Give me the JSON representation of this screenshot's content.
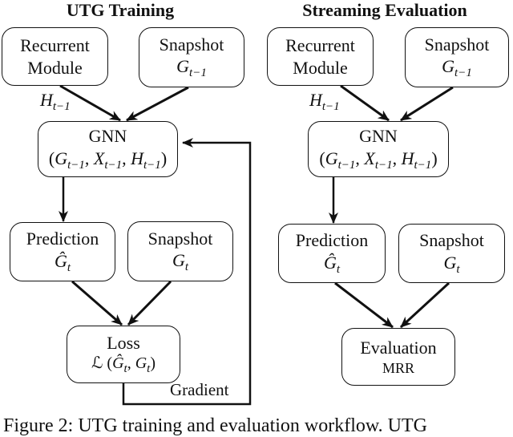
{
  "panels": [
    {
      "title": "UTG Training",
      "recurrent": {
        "line1": "Recurrent",
        "line2": "Module"
      },
      "snapshot_prev": {
        "label": "Snapshot",
        "math": "G",
        "sub": "t−1"
      },
      "h_label": {
        "math": "H",
        "sub": "t−1"
      },
      "gnn": {
        "label": "GNN",
        "args": [
          {
            "math": "G",
            "sub": "t−1"
          },
          {
            "math": "X",
            "sub": "t−1"
          },
          {
            "math": "H",
            "sub": "t−1"
          }
        ]
      },
      "prediction": {
        "label": "Prediction",
        "math": "Ĝ",
        "sub": "t"
      },
      "snapshot_cur": {
        "label": "Snapshot",
        "math": "G",
        "sub": "t"
      },
      "loss": {
        "label": "Loss",
        "formula_prefix": "ℒ (",
        "a": "Ĝ",
        "a_sub": "t",
        "b": "G",
        "b_sub": "t",
        "suffix": ")"
      },
      "gradient_label": "Gradient"
    },
    {
      "title": "Streaming Evaluation",
      "recurrent": {
        "line1": "Recurrent",
        "line2": "Module"
      },
      "snapshot_prev": {
        "label": "Snapshot",
        "math": "G",
        "sub": "t−1"
      },
      "h_label": {
        "math": "H",
        "sub": "t−1"
      },
      "gnn": {
        "label": "GNN",
        "args": [
          {
            "math": "G",
            "sub": "t−1"
          },
          {
            "math": "X",
            "sub": "t−1"
          },
          {
            "math": "H",
            "sub": "t−1"
          }
        ]
      },
      "prediction": {
        "label": "Prediction",
        "math": "Ĝ",
        "sub": "t"
      },
      "snapshot_cur": {
        "label": "Snapshot",
        "math": "G",
        "sub": "t"
      },
      "evaluation": {
        "label": "Evaluation",
        "metric": "MRR"
      }
    }
  ],
  "caption": "Figure 2: UTG training and evaluation workflow. UTG"
}
